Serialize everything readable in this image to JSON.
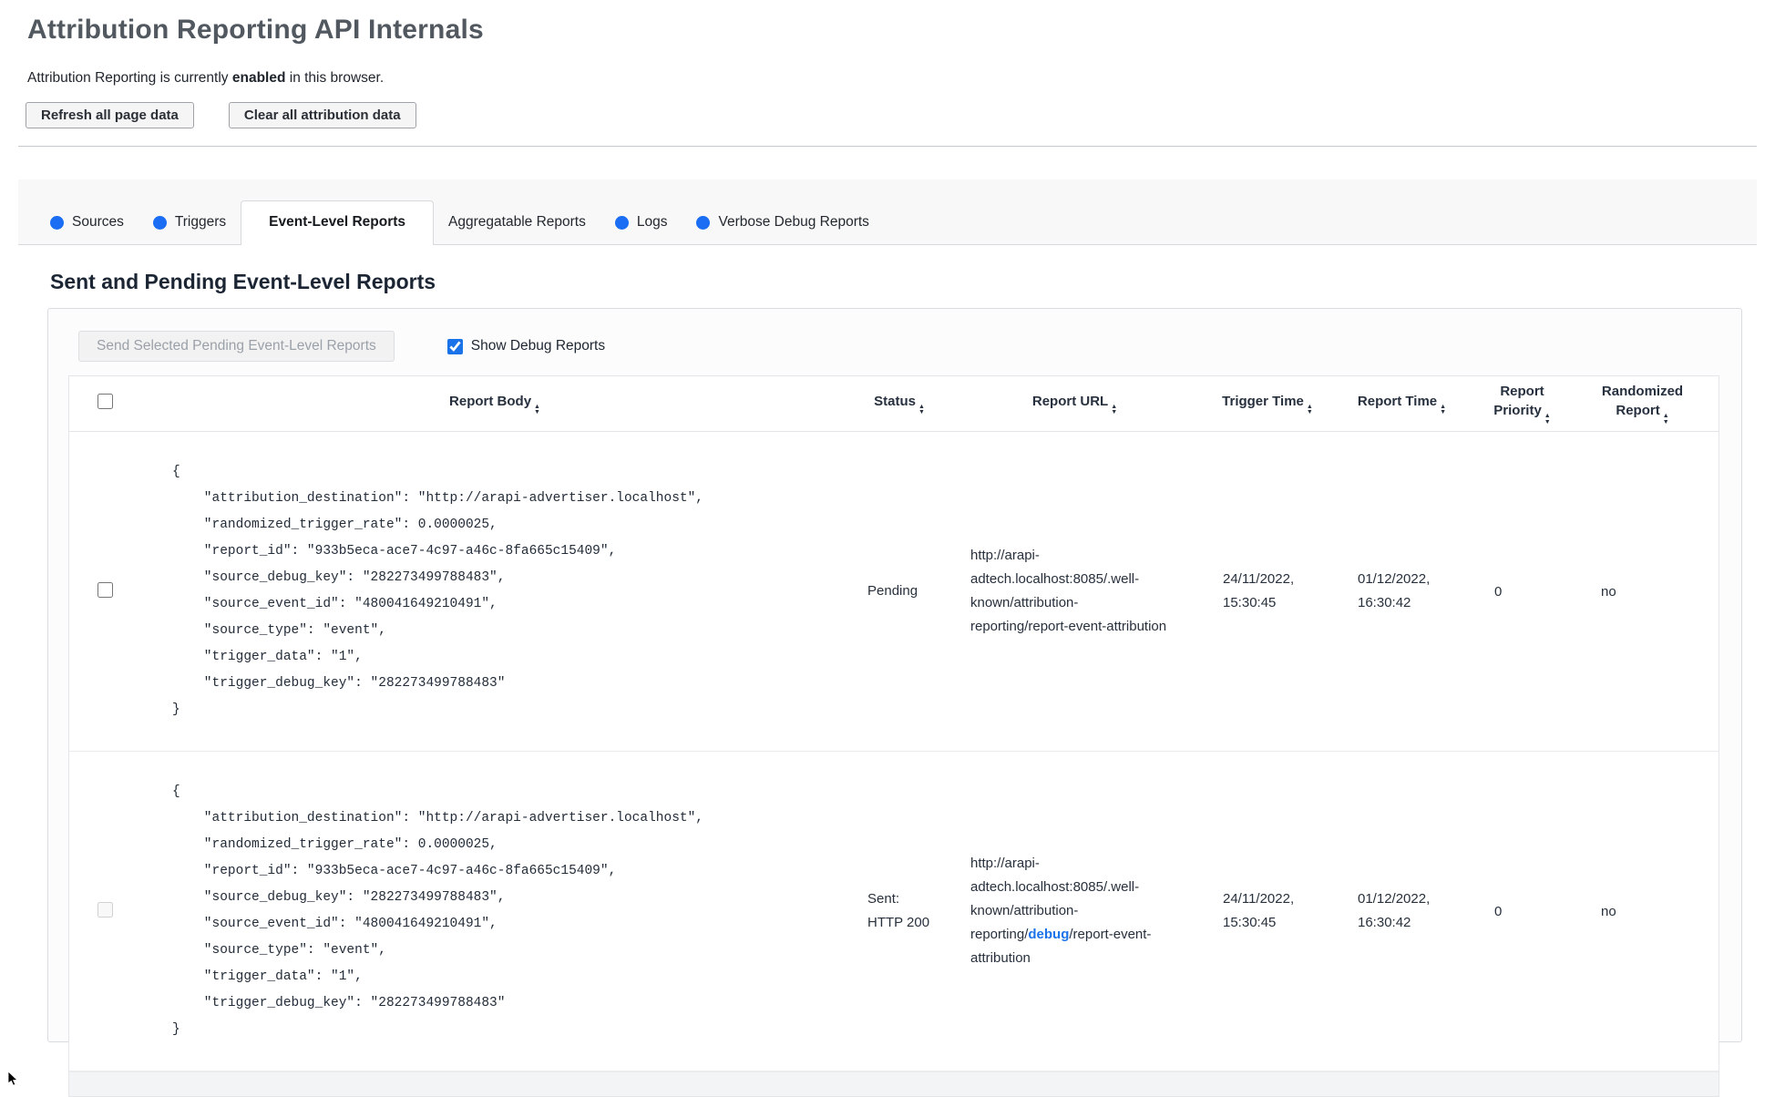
{
  "header": {
    "title": "Attribution Reporting API Internals",
    "status": {
      "prefix": "Attribution Reporting is currently ",
      "emphasis": "enabled",
      "suffix": " in this browser."
    },
    "buttons": {
      "refresh": "Refresh all page data",
      "clear": "Clear all attribution data"
    }
  },
  "tabs": [
    {
      "label": "Sources",
      "has_dot": true,
      "active": false
    },
    {
      "label": "Triggers",
      "has_dot": true,
      "active": false
    },
    {
      "label": "Event-Level Reports",
      "has_dot": false,
      "active": true
    },
    {
      "label": "Aggregatable Reports",
      "has_dot": false,
      "active": false
    },
    {
      "label": "Logs",
      "has_dot": true,
      "active": false
    },
    {
      "label": "Verbose Debug Reports",
      "has_dot": true,
      "active": false
    }
  ],
  "section": {
    "heading": "Sent and Pending Event-Level Reports",
    "send_button": "Send Selected Pending Event-Level Reports",
    "send_button_disabled": true,
    "show_debug": {
      "label": "Show Debug Reports",
      "checked": true
    }
  },
  "table": {
    "headers": {
      "report_body": "Report Body",
      "status": "Status",
      "report_url": "Report URL",
      "trigger_time": "Trigger Time",
      "report_time": "Report Time",
      "report_priority": "Report Priority",
      "randomized_report": "Randomized Report"
    },
    "rows": [
      {
        "report_body": "{\n    \"attribution_destination\": \"http://arapi-advertiser.localhost\",\n    \"randomized_trigger_rate\": 0.0000025,\n    \"report_id\": \"933b5eca-ace7-4c97-a46c-8fa665c15409\",\n    \"source_debug_key\": \"282273499788483\",\n    \"source_event_id\": \"480041649210491\",\n    \"source_type\": \"event\",\n    \"trigger_data\": \"1\",\n    \"trigger_debug_key\": \"282273499788483\"\n}",
        "status": "Pending",
        "report_url": {
          "prefix": "http://arapi-adtech.localhost:8085/.well-known/attribution-reporting/",
          "debug_link": "",
          "suffix": "report-event-attribution"
        },
        "trigger_time": "24/11/2022, 15:30:45",
        "report_time": "01/12/2022, 16:30:42",
        "report_priority": "0",
        "randomized_report": "no",
        "checkbox_disabled": false
      },
      {
        "report_body": "{\n    \"attribution_destination\": \"http://arapi-advertiser.localhost\",\n    \"randomized_trigger_rate\": 0.0000025,\n    \"report_id\": \"933b5eca-ace7-4c97-a46c-8fa665c15409\",\n    \"source_debug_key\": \"282273499788483\",\n    \"source_event_id\": \"480041649210491\",\n    \"source_type\": \"event\",\n    \"trigger_data\": \"1\",\n    \"trigger_debug_key\": \"282273499788483\"\n}",
        "status": "Sent: HTTP 200",
        "report_url": {
          "prefix": "http://arapi-adtech.localhost:8085/.well-known/attribution-reporting/",
          "debug_link": "debug",
          "suffix": "/report-event-attribution"
        },
        "trigger_time": "24/11/2022, 15:30:45",
        "report_time": "01/12/2022, 16:30:42",
        "report_priority": "0",
        "randomized_report": "no",
        "checkbox_disabled": true
      }
    ]
  },
  "icons": {
    "sort_up": "▲",
    "sort_down": "▼"
  },
  "colors": {
    "accent_blue": "#1a73e8",
    "tab_dot_blue": "#1b6ef3",
    "heading_text": "#1b2533",
    "title_text": "#52585f",
    "disabled_button_text": "#9ba1a8",
    "tabstrip_background": "#f8f8f8"
  }
}
